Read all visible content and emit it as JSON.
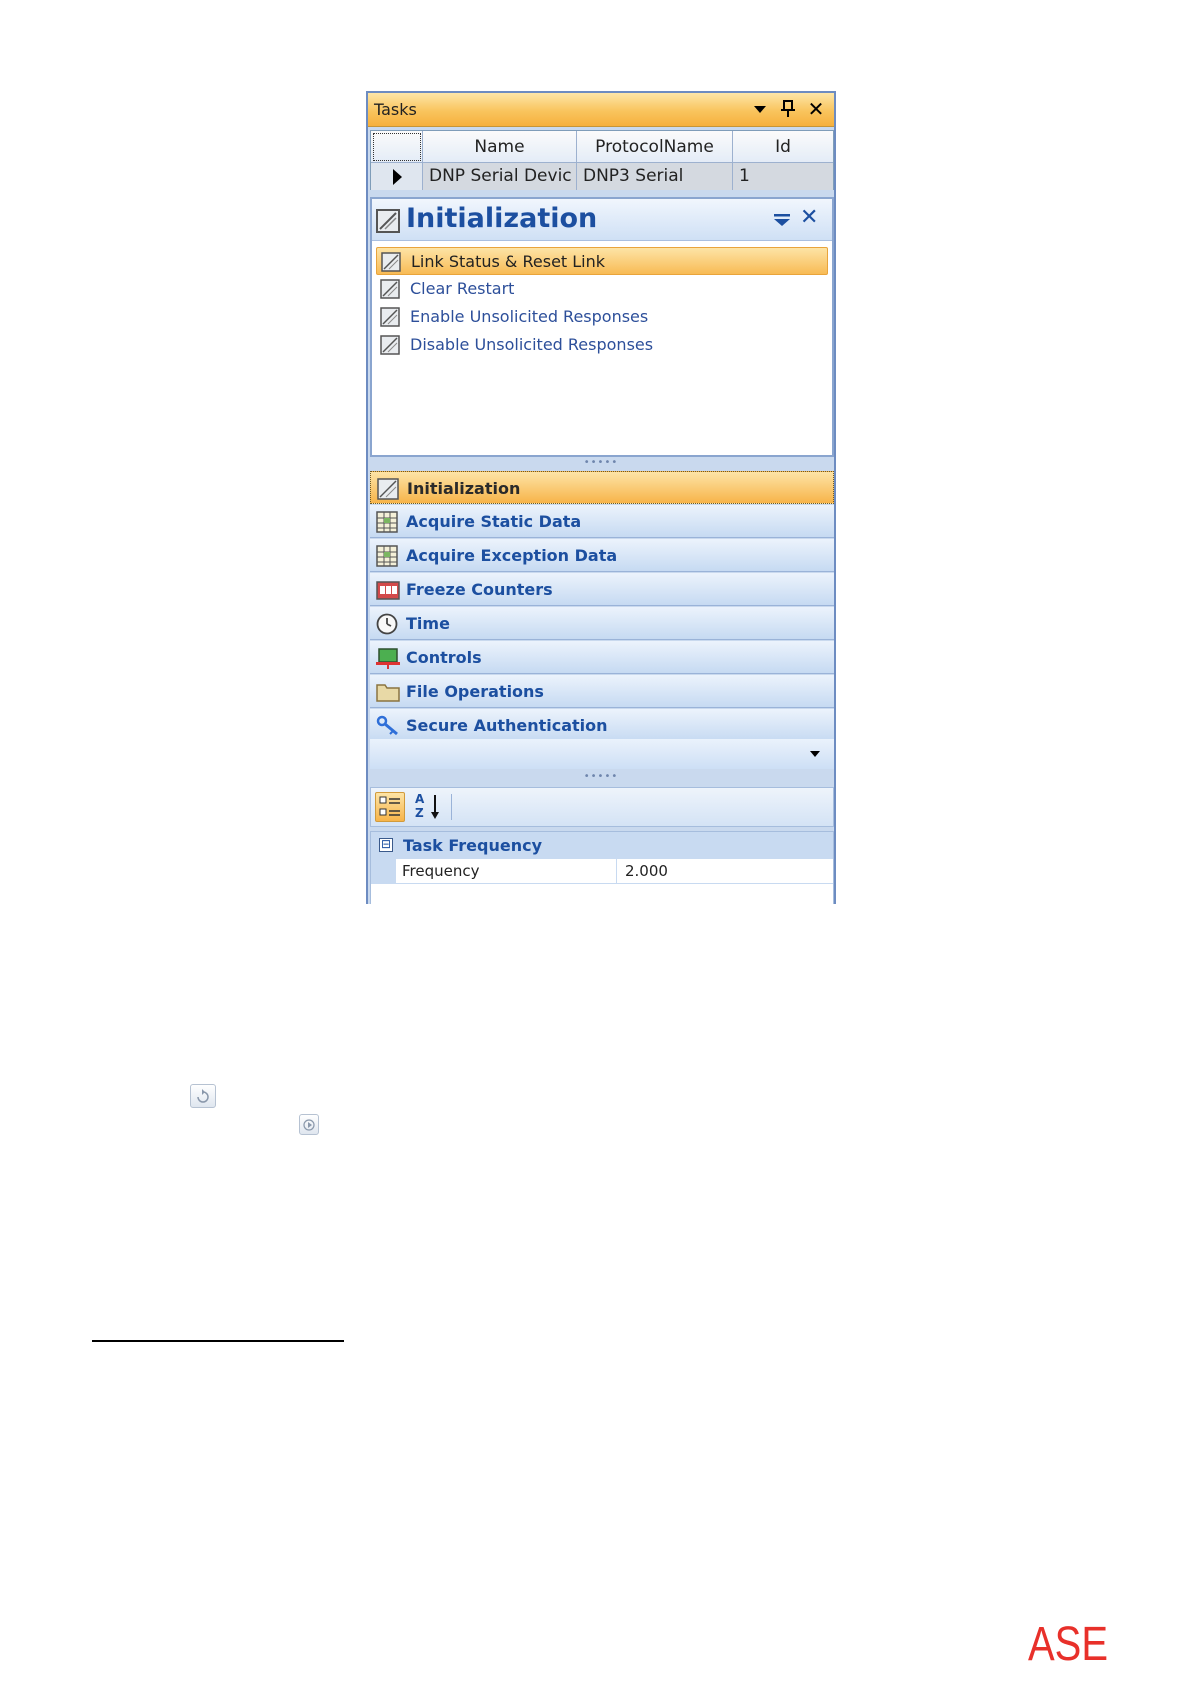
{
  "window": {
    "title": "Tasks"
  },
  "grid": {
    "columns": [
      "Name",
      "ProtocolName",
      "Id"
    ],
    "rows": [
      {
        "name": "DNP  Serial Devic",
        "protocol": "DNP3 Serial",
        "id": "1"
      }
    ]
  },
  "task_panel": {
    "title": "Initialization",
    "items": [
      {
        "label": "Link Status & Reset Link",
        "selected": true
      },
      {
        "label": "Clear Restart",
        "selected": false
      },
      {
        "label": "Enable Unsolicited Responses",
        "selected": false
      },
      {
        "label": "Disable Unsolicited Responses",
        "selected": false
      }
    ]
  },
  "navigation": {
    "items": [
      {
        "label": "Initialization",
        "icon": "initialization-icon",
        "selected": true
      },
      {
        "label": "Acquire Static Data",
        "icon": "table-icon",
        "selected": false
      },
      {
        "label": "Acquire Exception Data",
        "icon": "table-icon",
        "selected": false
      },
      {
        "label": "Freeze Counters",
        "icon": "counter-icon",
        "selected": false
      },
      {
        "label": "Time",
        "icon": "clock-icon",
        "selected": false
      },
      {
        "label": "Controls",
        "icon": "controls-icon",
        "selected": false
      },
      {
        "label": "File Operations",
        "icon": "folder-icon",
        "selected": false
      },
      {
        "label": "Secure Authentication",
        "icon": "key-icon",
        "selected": false
      }
    ]
  },
  "property_grid": {
    "sort_az_label": "AZ",
    "category": "Task Frequency",
    "expander": "⊟",
    "properties": [
      {
        "name": "Frequency",
        "value": "2.000"
      }
    ]
  },
  "logo": {
    "text": "ASE",
    "color": "#e8302a"
  },
  "colors": {
    "accent_orange": "#f7b449",
    "panel_blue": "#c6daf2",
    "title_blue": "#1c4fa0"
  }
}
